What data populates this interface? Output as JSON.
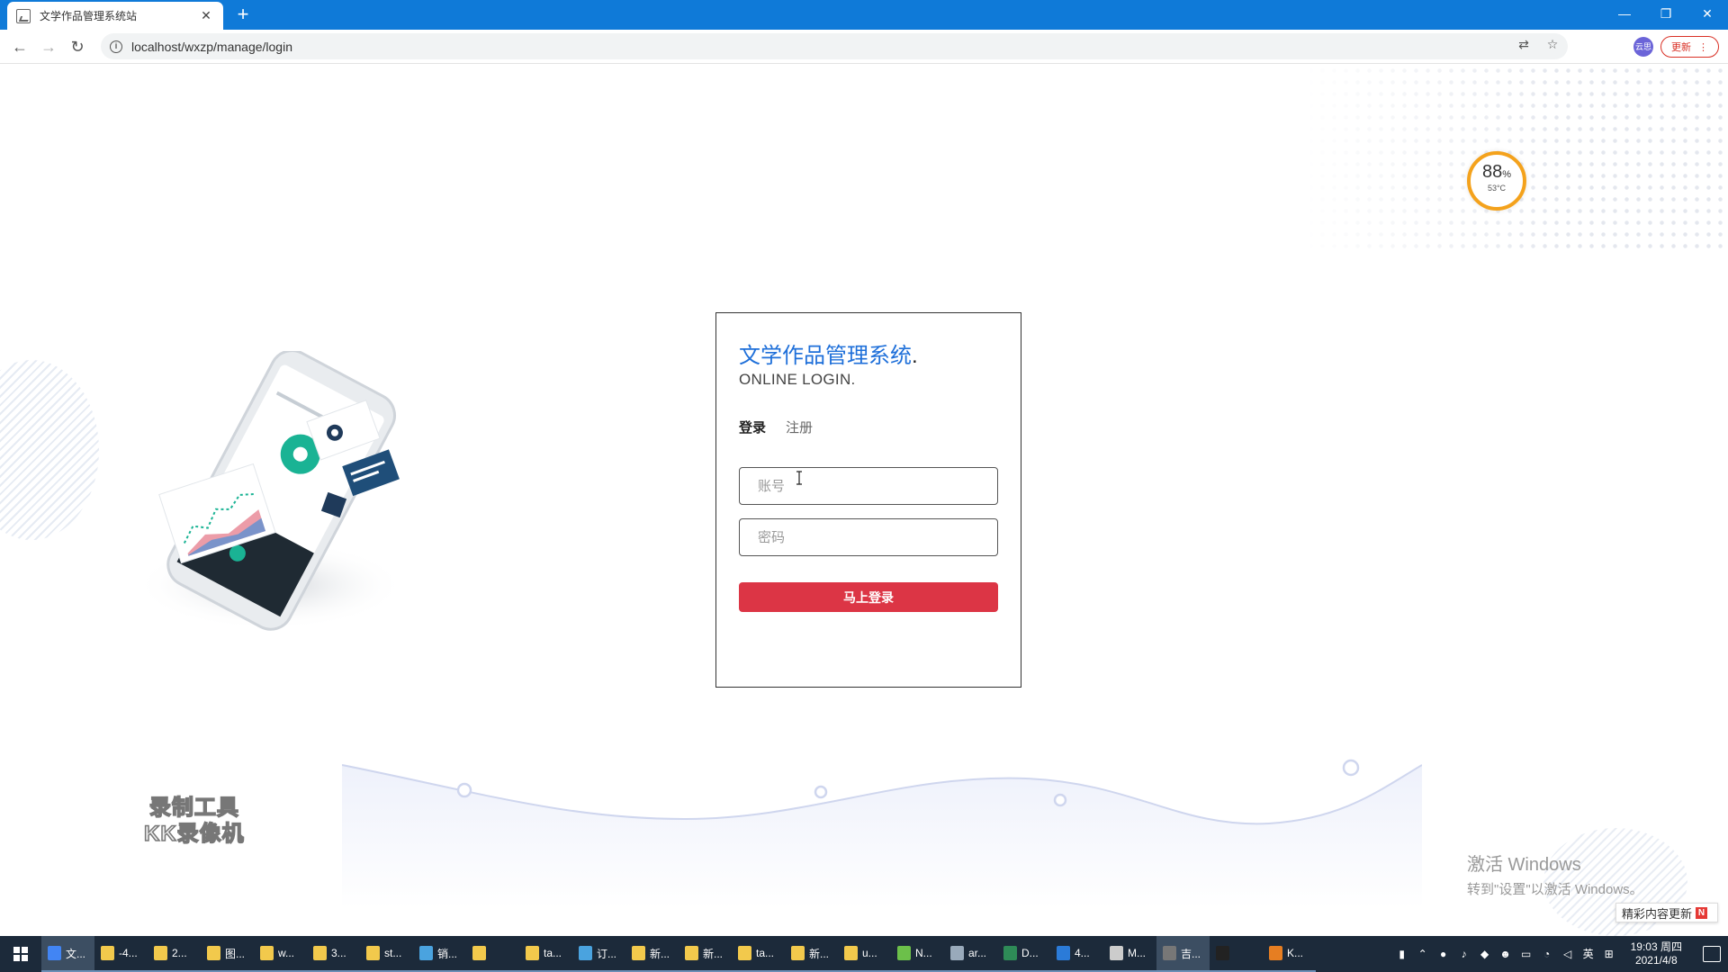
{
  "browser": {
    "tab_title": "文学作品管理系统站",
    "tab_close": "✕",
    "new_tab": "+",
    "url": "localhost/wxzp/manage/login",
    "profile_label": "云思",
    "update_label": "更新",
    "window_controls": [
      "—",
      "❐",
      "✕"
    ]
  },
  "gauge": {
    "percent": "88",
    "percent_unit": "%",
    "temperature": "53°C"
  },
  "login": {
    "title": "文学作品管理系统",
    "title_dot": ".",
    "subtitle": "ONLINE LOGIN.",
    "tabs": [
      {
        "label": "登录",
        "active": true
      },
      {
        "label": "注册",
        "active": false
      }
    ],
    "username_placeholder": "账号",
    "password_placeholder": "密码",
    "submit_label": "马上登录"
  },
  "watermarks": {
    "recorder_line1": "录制工具",
    "recorder_line2": "KK录像机",
    "activate_title": "激活 Windows",
    "activate_sub": "转到\"设置\"以激活 Windows。",
    "news_label": "精彩内容更新",
    "news_badge": "N"
  },
  "taskbar": {
    "items": [
      {
        "label": "文...",
        "icon": "chrome-icon",
        "color": "#4285f4",
        "active": true
      },
      {
        "label": "-4...",
        "icon": "folder-icon",
        "color": "#f2c94c"
      },
      {
        "label": "2...",
        "icon": "folder-icon",
        "color": "#f2c94c"
      },
      {
        "label": "图...",
        "icon": "folder-icon",
        "color": "#f2c94c"
      },
      {
        "label": "w...",
        "icon": "folder-icon",
        "color": "#f2c94c"
      },
      {
        "label": "3...",
        "icon": "folder-icon",
        "color": "#f2c94c"
      },
      {
        "label": "st...",
        "icon": "folder-icon",
        "color": "#f2c94c"
      },
      {
        "label": "销...",
        "icon": "cube-icon",
        "color": "#4aa3df"
      },
      {
        "label": "",
        "icon": "folder-icon",
        "color": "#f2c94c"
      },
      {
        "label": "ta...",
        "icon": "folder-icon",
        "color": "#f2c94c"
      },
      {
        "label": "订...",
        "icon": "cube-icon",
        "color": "#4aa3df"
      },
      {
        "label": "新...",
        "icon": "folder-icon",
        "color": "#f2c94c"
      },
      {
        "label": "新...",
        "icon": "folder-icon",
        "color": "#f2c94c"
      },
      {
        "label": "ta...",
        "icon": "folder-icon",
        "color": "#f2c94c"
      },
      {
        "label": "新...",
        "icon": "folder-icon",
        "color": "#f2c94c"
      },
      {
        "label": "u...",
        "icon": "folder-icon",
        "color": "#f2c94c"
      },
      {
        "label": "N...",
        "icon": "notepad-icon",
        "color": "#6cc04a"
      },
      {
        "label": "ar...",
        "icon": "archive-icon",
        "color": "#9ab"
      },
      {
        "label": "D...",
        "icon": "document-icon",
        "color": "#2e8b57"
      },
      {
        "label": "4...",
        "icon": "vscode-icon",
        "color": "#2b7bd8"
      },
      {
        "label": "M...",
        "icon": "pen-icon",
        "color": "#ccc"
      },
      {
        "label": "吉...",
        "icon": "app-icon",
        "color": "#777",
        "active": true
      },
      {
        "label": "",
        "icon": "qq-icon",
        "color": "#222"
      },
      {
        "label": "K...",
        "icon": "recorder-icon",
        "color": "#e67e22"
      }
    ],
    "clock_time": "19:03 周四",
    "clock_date": "2021/4/8",
    "ime": "英",
    "tray_icons": [
      "battery-icon",
      "chevron-up-icon",
      "security-icon",
      "bell-icon",
      "shield-icon",
      "qq-tray-icon",
      "device-icon",
      "wifi-icon",
      "mute-icon"
    ]
  }
}
